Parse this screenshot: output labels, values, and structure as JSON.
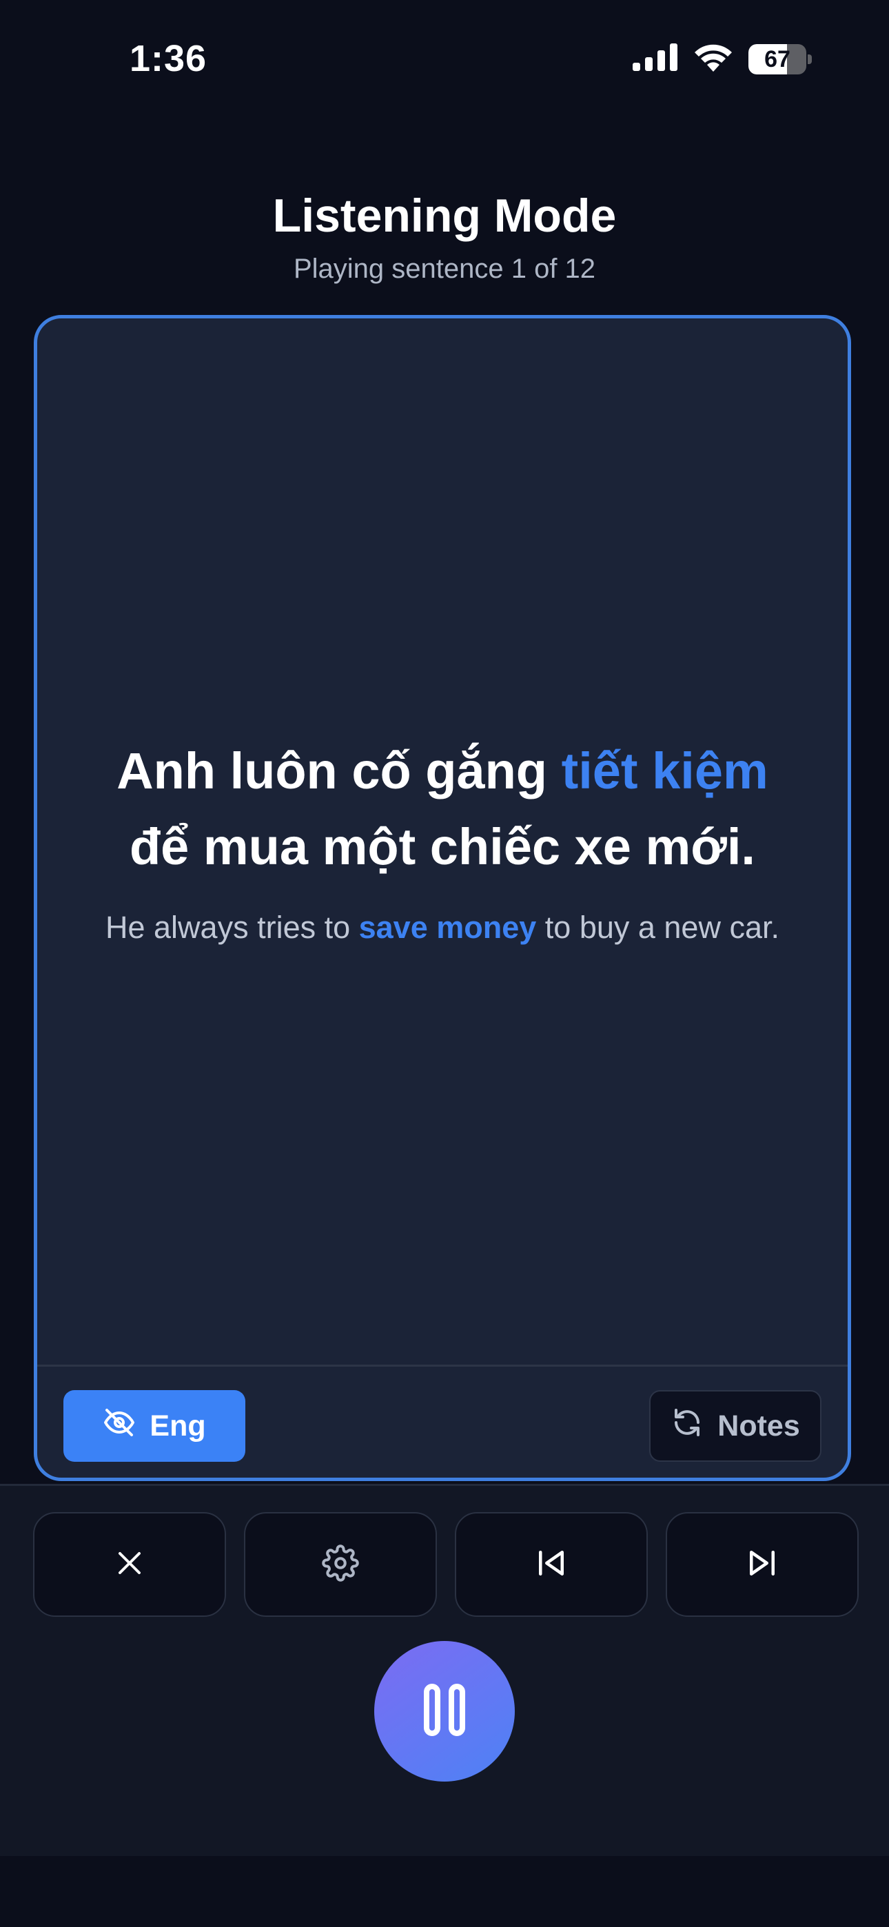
{
  "status_bar": {
    "time": "1:36",
    "battery_level": "67",
    "battery_fraction": 0.67
  },
  "header": {
    "title": "Listening Mode",
    "subtitle": "Playing sentence 1 of 12"
  },
  "card": {
    "sentence": {
      "line1_before": "Anh luôn cố gắng ",
      "line1_highlight": "tiết kiệm",
      "line2": "để mua một chiếc xe mới."
    },
    "translation": {
      "before": "He always tries to ",
      "highlight": "save money",
      "after": " to buy a new car."
    },
    "eng_button_label": "Eng",
    "notes_button_label": "Notes"
  },
  "controls": {
    "icons": [
      "close-icon",
      "settings-gear-icon",
      "skip-previous-icon",
      "skip-next-icon",
      "pause-icon"
    ]
  },
  "colors": {
    "background": "#0b0e1b",
    "card_background": "#1b2337",
    "card_border": "#3f7fe0",
    "accent": "#3b82f6",
    "highlight_text": "#3d82f2",
    "play_gradient_start": "#7c6cf2",
    "play_gradient_end": "#4d82f5"
  }
}
